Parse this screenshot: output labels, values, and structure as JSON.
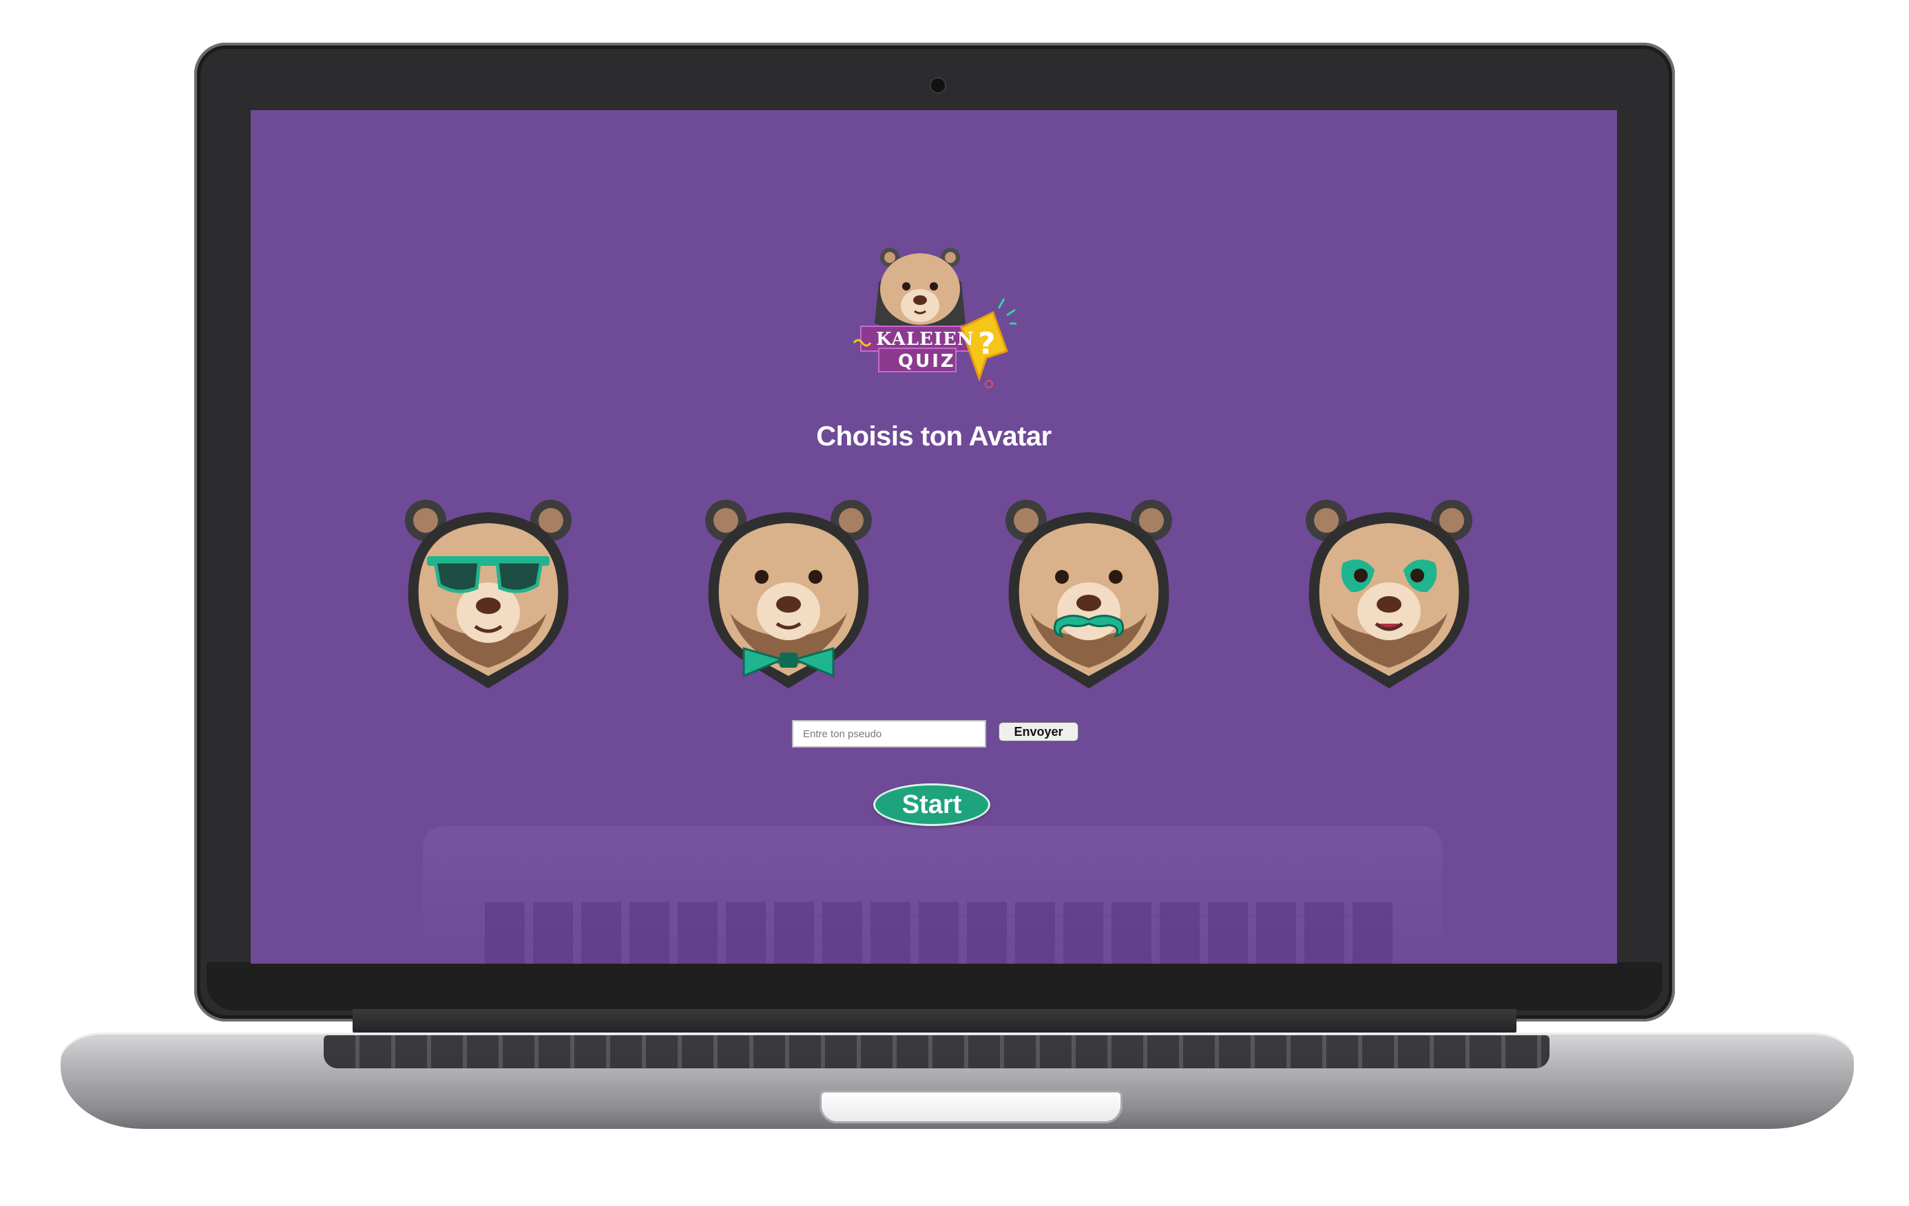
{
  "app": {
    "logo_line1": "KALEIEN",
    "logo_line2": "QUIZ"
  },
  "page": {
    "title": "Choisis ton Avatar"
  },
  "avatars": [
    {
      "name": "bear-sunglasses",
      "accessory": "sunglasses"
    },
    {
      "name": "bear-bowtie",
      "accessory": "bowtie"
    },
    {
      "name": "bear-mustache",
      "accessory": "mustache"
    },
    {
      "name": "bear-face-paint",
      "accessory": "face-paint"
    }
  ],
  "form": {
    "pseudo_placeholder": "Entre ton pseudo",
    "pseudo_value": "",
    "send_label": "Envoyer",
    "start_label": "Start"
  },
  "colors": {
    "background": "#6f4a97",
    "accent": "#1ea37d",
    "bear_fur": "#d9b18a",
    "logo_yellow": "#f5c518"
  }
}
